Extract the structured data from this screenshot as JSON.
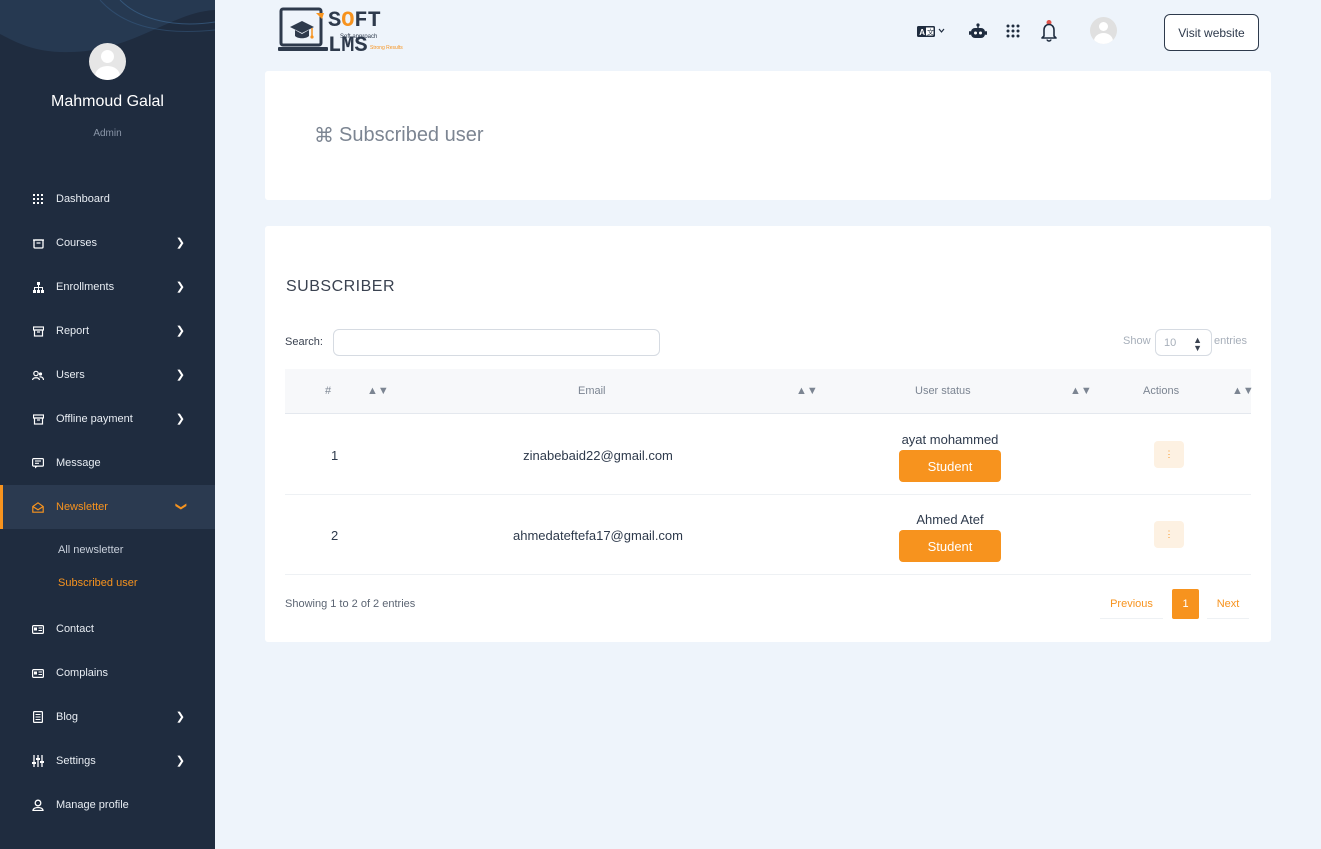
{
  "sidebar": {
    "profile": {
      "name": "Mahmoud Galal",
      "role": "Admin"
    },
    "items": [
      {
        "label": "Dashboard",
        "icon": "grid-icon",
        "has_children": false
      },
      {
        "label": "Courses",
        "icon": "courses-icon",
        "has_children": true
      },
      {
        "label": "Enrollments",
        "icon": "sitemap-icon",
        "has_children": true
      },
      {
        "label": "Report",
        "icon": "archive-icon",
        "has_children": true
      },
      {
        "label": "Users",
        "icon": "users-icon",
        "has_children": true
      },
      {
        "label": "Offline payment",
        "icon": "archive-icon",
        "has_children": true
      },
      {
        "label": "Message",
        "icon": "chat-icon",
        "has_children": false
      },
      {
        "label": "Newsletter",
        "icon": "mail-open-icon",
        "has_children": true,
        "expanded": true
      },
      {
        "label": "Contact",
        "icon": "card-icon",
        "has_children": false
      },
      {
        "label": "Complains",
        "icon": "card-icon",
        "has_children": false
      },
      {
        "label": "Blog",
        "icon": "document-icon",
        "has_children": true
      },
      {
        "label": "Settings",
        "icon": "sliders-icon",
        "has_children": true
      },
      {
        "label": "Manage profile",
        "icon": "user-icon",
        "has_children": false
      }
    ],
    "newsletter_submenu": [
      {
        "label": "All newsletter"
      },
      {
        "label": "Subscribed user"
      }
    ]
  },
  "header": {
    "logo": {
      "title_prefix": "S",
      "title_o": "O",
      "title_rest": "FT LMS",
      "tagline_1": "Soft approach",
      "tagline_2": "Strong Results"
    },
    "icons": [
      "language-icon",
      "robot-icon",
      "apps-grid-icon",
      "bell-icon",
      "avatar"
    ],
    "visit_label": "Visit website"
  },
  "page": {
    "title": "Subscribed user",
    "title_icon": "command-icon"
  },
  "table": {
    "section_title": "SUBSCRIBER",
    "search_label": "Search:",
    "search_value": "",
    "show_label": "Show",
    "show_value": "10",
    "entries_label": "entries",
    "columns": [
      "#",
      "Email",
      "User status",
      "Actions"
    ],
    "rows": [
      {
        "num": "1",
        "email": "zinabebaid22@gmail.com",
        "name": "ayat mohammed",
        "status": "Student"
      },
      {
        "num": "2",
        "email": "ahmedateftefa17@gmail.com",
        "name": "Ahmed Atef",
        "status": "Student"
      }
    ],
    "action_glyph": "⋮",
    "footer": {
      "showing": "Showing 1 to 2 of 2 entries",
      "previous": "Previous",
      "current_page": "1",
      "next": "Next"
    }
  },
  "colors": {
    "accent": "#f7931e",
    "sidebar_bg": "#1f2c3f",
    "page_bg": "#eef4fb"
  }
}
